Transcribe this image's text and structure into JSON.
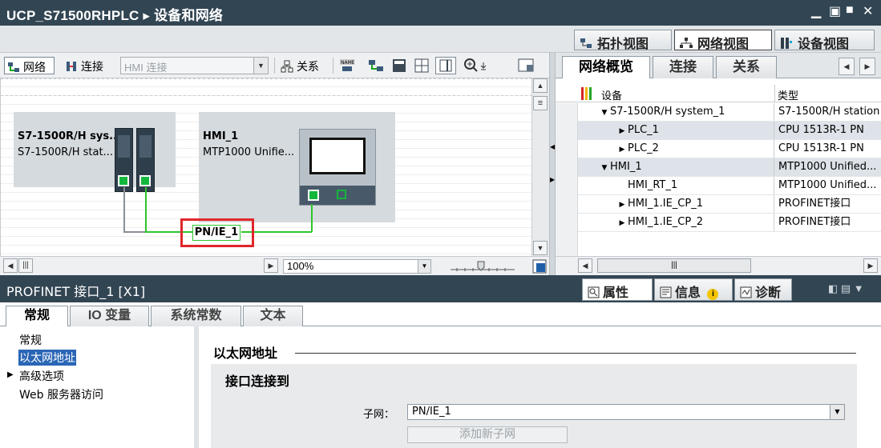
{
  "window": {
    "title": "UCP_S71500RHPLC ▸ 设备和网络"
  },
  "views": {
    "topology": "拓扑视图",
    "network": "网络视图",
    "device": "设备视图"
  },
  "toolbar": {
    "network": "网络",
    "connections": "连接",
    "hmi_connection": "HMI 连接",
    "relations": "关系"
  },
  "canvas": {
    "station1": {
      "name": "S7-1500R/H sys...",
      "type": "S7-1500R/H stat..."
    },
    "station2": {
      "name": "HMI_1",
      "type": "MTP1000 Unifie..."
    },
    "subnet_label": "PN/IE_1",
    "zoom": "100%"
  },
  "overview": {
    "tabs": [
      "网络概览",
      "连接",
      "关系"
    ],
    "col_device": "设备",
    "col_type": "类型",
    "rows": [
      {
        "device": "S7-1500R/H system_1",
        "type": "S7-1500R/H station",
        "level": 1,
        "expander": "expanded"
      },
      {
        "device": "PLC_1",
        "type": "CPU 1513R-1 PN",
        "level": 2,
        "expander": "collapsed"
      },
      {
        "device": "PLC_2",
        "type": "CPU 1513R-1 PN",
        "level": 2,
        "expander": "collapsed"
      },
      {
        "device": "HMI_1",
        "type": "MTP1000 Unified...",
        "level": 1,
        "expander": "expanded"
      },
      {
        "device": "HMI_RT_1",
        "type": "MTP1000 Unified...",
        "level": 2,
        "expander": "none"
      },
      {
        "device": "HMI_1.IE_CP_1",
        "type": "PROFINET接口",
        "level": 2,
        "expander": "collapsed"
      },
      {
        "device": "HMI_1.IE_CP_2",
        "type": "PROFINET接口",
        "level": 2,
        "expander": "collapsed"
      }
    ]
  },
  "properties": {
    "title": "PROFINET 接口_1 [X1]",
    "tabs": {
      "props": "属性",
      "info": "信息",
      "diag": "诊断"
    },
    "subtabs": [
      "常规",
      "IO 变量",
      "系统常数",
      "文本"
    ],
    "nav": [
      "常规",
      "以太网地址",
      "高级选项",
      "Web 服务器访问"
    ],
    "section_title": "以太网地址",
    "panel_title": "接口连接到",
    "subnet_label": "子网：",
    "subnet_value": "PN/IE_1",
    "add_subnet": "添加新子网"
  },
  "colors": {
    "titlebar": "#324553",
    "network_green": "#2ec52e",
    "highlight_red": "#e0272b",
    "selection_blue": "#2a66b6"
  }
}
